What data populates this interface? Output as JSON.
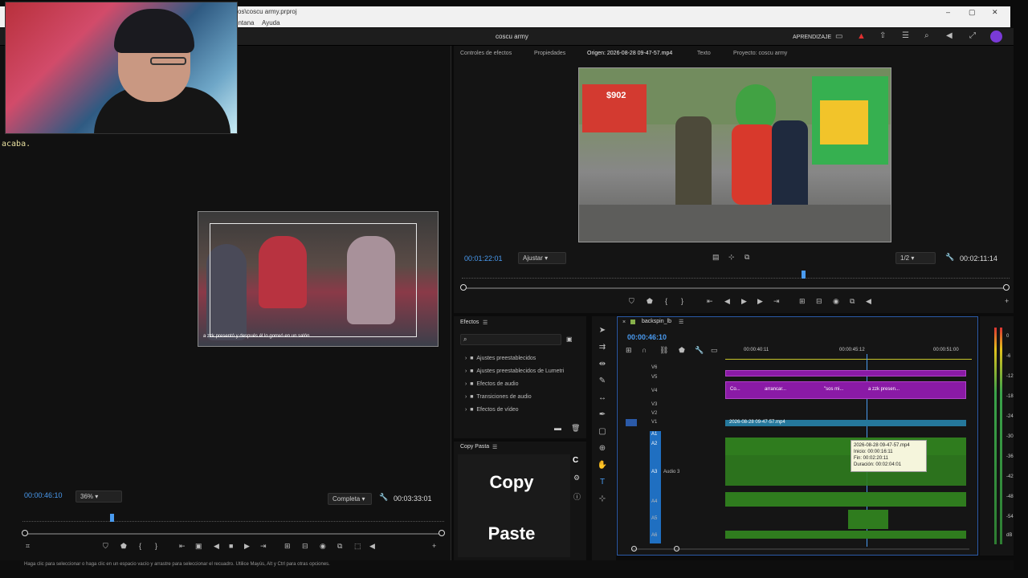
{
  "window": {
    "title": "vos\\coscu army.prproj",
    "minimize": "–",
    "maximize": "▢",
    "close": "✕"
  },
  "menu": {
    "items": [
      "entana",
      "Ayuda"
    ]
  },
  "app": {
    "project_title": "coscu army",
    "learn_label": "APRENDIZAJE"
  },
  "webcam": {
    "caption": "acaba."
  },
  "program": {
    "timecode": "00:00:46:10",
    "zoom": "36%",
    "quality": "Completa",
    "duration": "00:03:33:01",
    "video_caption": "a zzk presentó y después él lo gorreó en un salón"
  },
  "source": {
    "tabs": [
      "Controles de efectos",
      "Propiedades",
      "Origen: 2026-08-28 09-47-57.mp4",
      "Texto",
      "Proyecto: coscu army"
    ],
    "timecode": "00:01:22:01",
    "fit": "Ajustar",
    "resolution": "1/2",
    "duration": "00:02:11:14",
    "sign_price": "$902"
  },
  "effects": {
    "title": "Efectos",
    "items": [
      "Ajustes preestablecidos",
      "Ajustes preestablecidos de Lumetri",
      "Efectos de audio",
      "Transiciones de audio",
      "Efectos de vídeo"
    ]
  },
  "copypaste": {
    "title": "Copy Pasta",
    "copy": "Copy",
    "paste": "Paste"
  },
  "timeline": {
    "sequence": "backspin_lb",
    "timecode": "00:00:46:10",
    "ruler": [
      "00:00:40:11",
      "00:00:45:12",
      "00:00:51:00"
    ],
    "video_tracks": [
      "V6",
      "V5",
      "V4",
      "V3",
      "V2",
      "V1"
    ],
    "audio_tracks": [
      "A1",
      "A2",
      "A3",
      "A4",
      "A5",
      "A6"
    ],
    "audio3_name": "Audio 3",
    "v4_clips": [
      "Co...",
      "arrancar...",
      "\"sos mi...",
      "a zzk presen..."
    ],
    "v1_clip": "2026-08-28 09-47-57.mp4",
    "tooltip": {
      "name": "2026-08-28 09-47-57.mp4",
      "start": "Inicio: 00:00:16:11",
      "end": "Fin: 00:02:20:11",
      "duration": "Duración: 00:02:04:01"
    }
  },
  "meter": {
    "ticks": [
      "0",
      "-6",
      "-12",
      "-18",
      "-24",
      "-30",
      "-36",
      "-42",
      "-48",
      "-54",
      "dB"
    ]
  },
  "status": {
    "text": "Haga clic para seleccionar o haga clic en un espacio vacío y arrastre para seleccionar el recuadro. Utilice Mayús, Alt y Ctrl para otras opciones."
  },
  "colors": {
    "accent": "#4a9bf0",
    "purple_clip": "#8a1aa6",
    "audio_clip": "#2f7c1e",
    "video_clip": "#25789c"
  }
}
